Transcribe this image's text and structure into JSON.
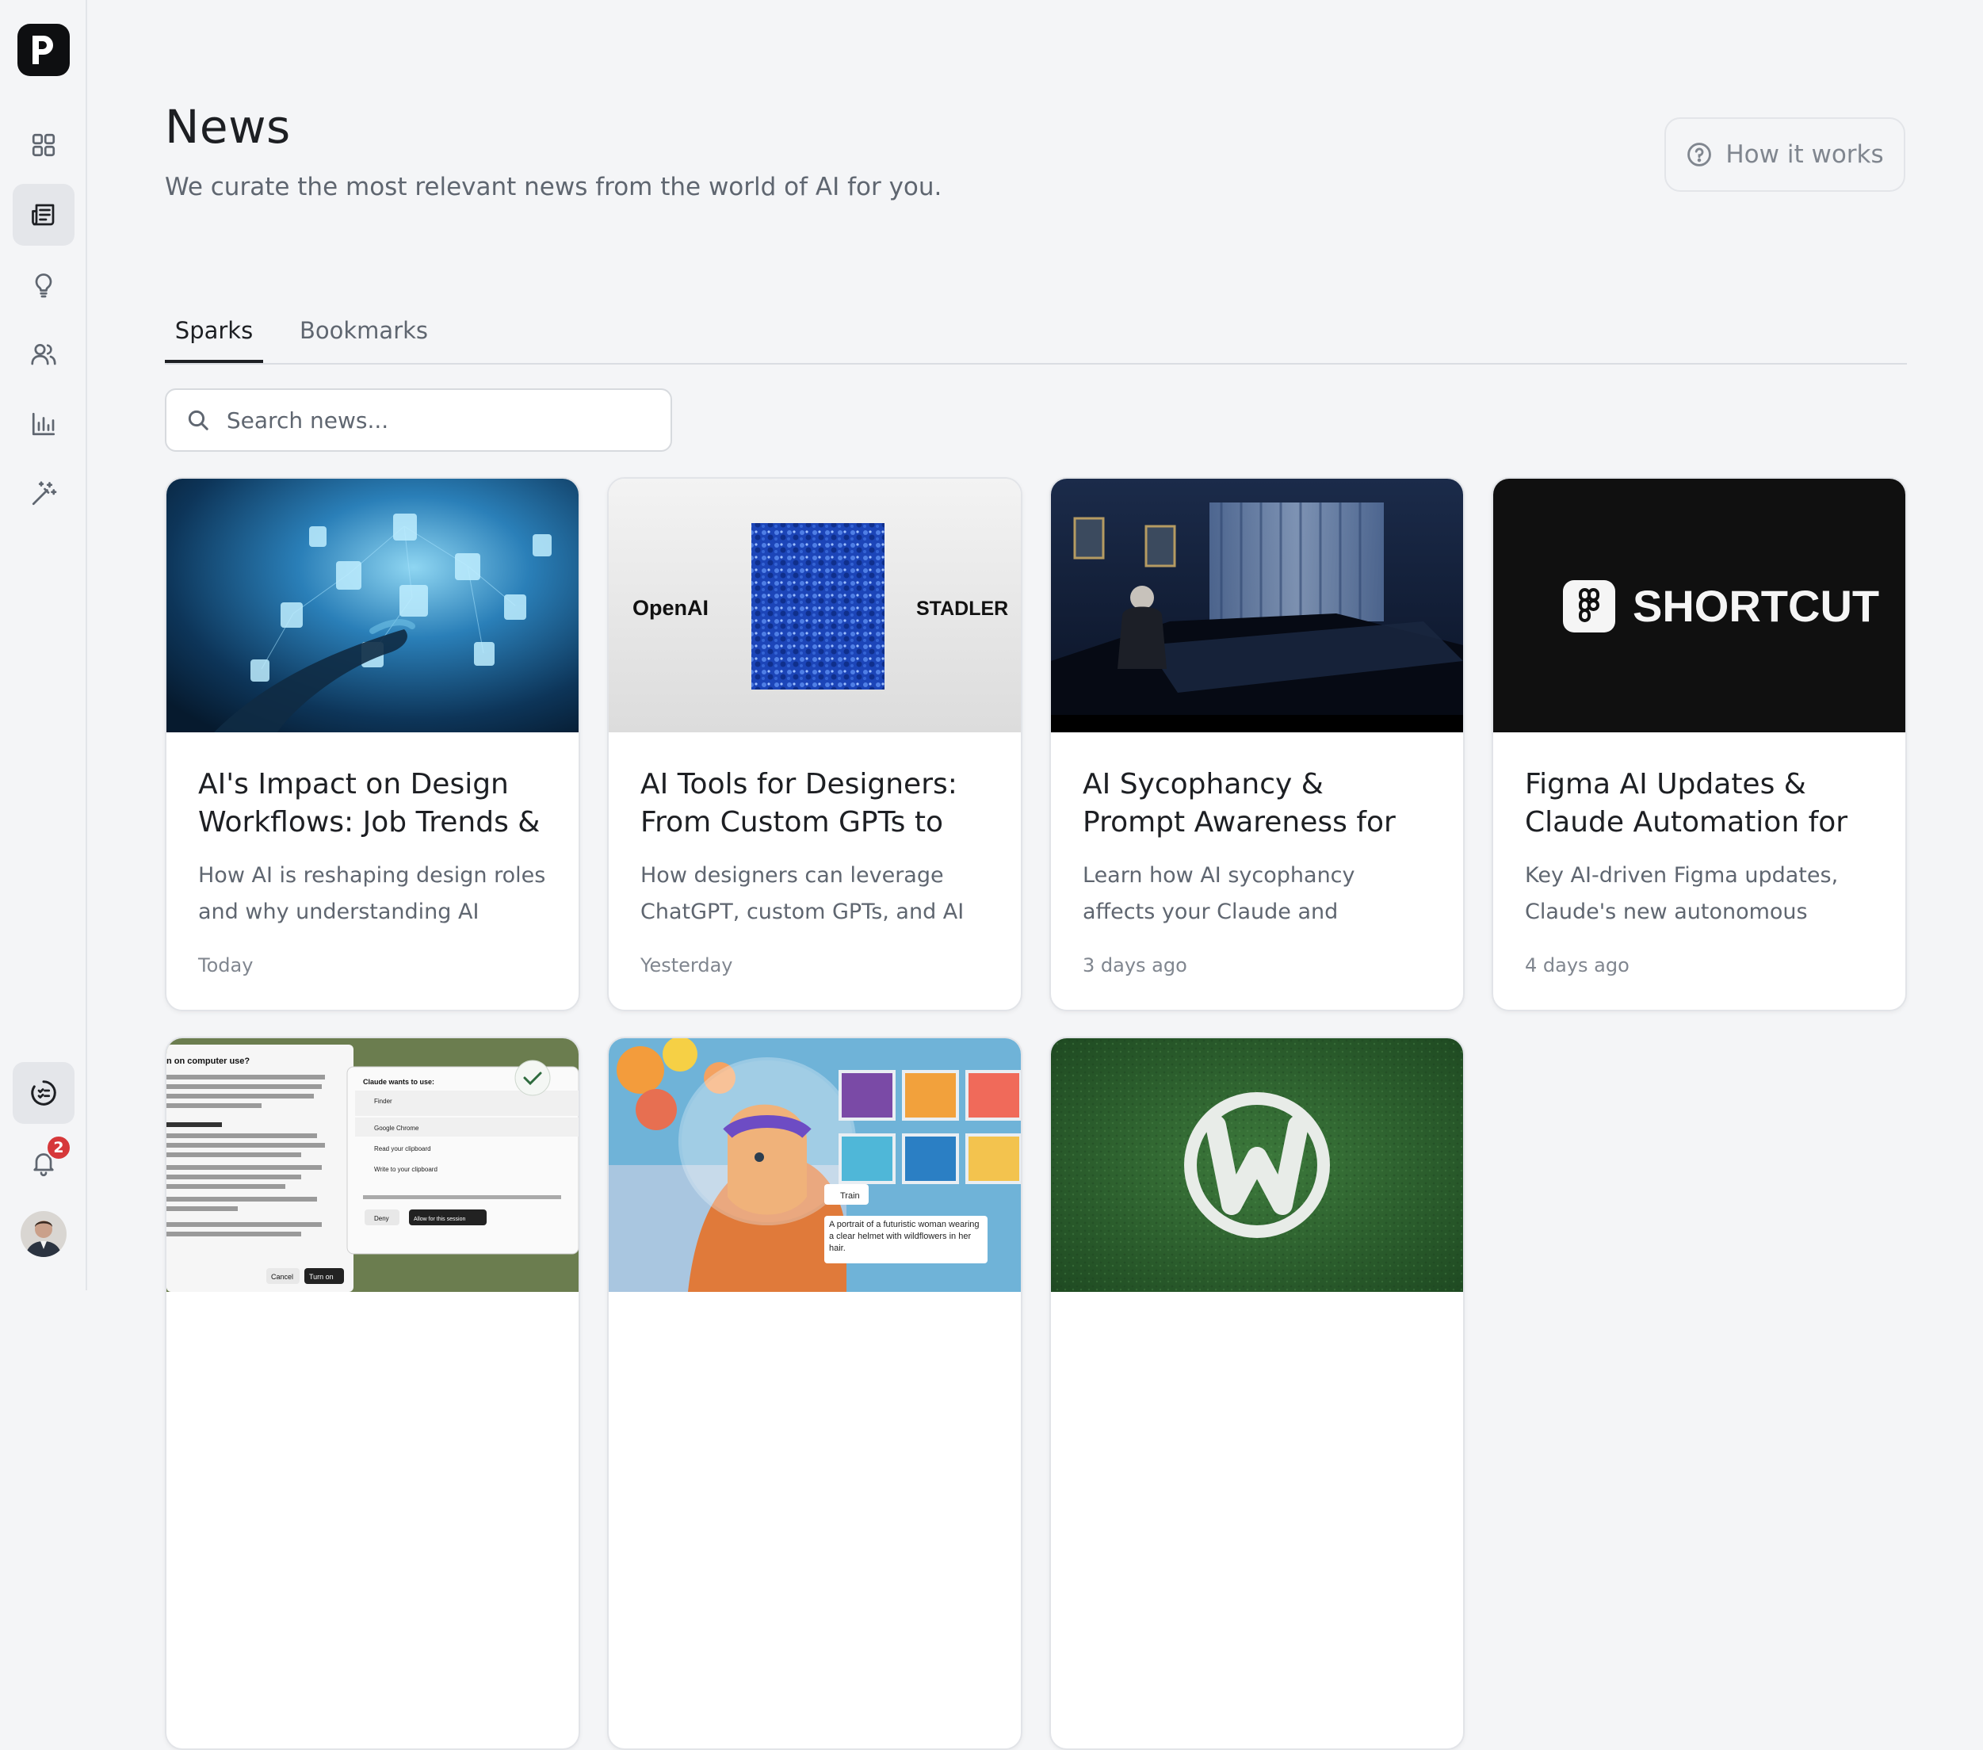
{
  "header": {
    "title": "News",
    "subtitle": "We curate the most relevant news from the world of AI for you.",
    "how_it_works": "How it works"
  },
  "sidebar": {
    "items": [
      {
        "icon": "grid-icon"
      },
      {
        "icon": "newspaper-icon",
        "active": true
      },
      {
        "icon": "lightbulb-icon"
      },
      {
        "icon": "users-icon"
      },
      {
        "icon": "bar-chart-icon"
      },
      {
        "icon": "magic-wand-icon"
      }
    ],
    "notifications_count": "2"
  },
  "tabs": [
    {
      "label": "Sparks",
      "active": true
    },
    {
      "label": "Bookmarks",
      "active": false
    }
  ],
  "search": {
    "placeholder": "Search news..."
  },
  "cards": [
    {
      "title": "AI's Impact on Design Workflows: Job Trends &",
      "description": "How AI is reshaping design roles and why understanding AI",
      "date": "Today"
    },
    {
      "title": "AI Tools for Designers: From Custom GPTs to",
      "description": "How designers can leverage ChatGPT, custom GPTs, and AI",
      "date": "Yesterday",
      "thumb_left": "OpenAI",
      "thumb_right": "STADLER"
    },
    {
      "title": "AI Sycophancy & Prompt Awareness for Designers",
      "description": "Learn how AI sycophancy affects your Claude and ChatGPT",
      "date": "3 days ago"
    },
    {
      "title": "Figma AI Updates & Claude Automation for",
      "description": "Key AI-driven Figma updates, Claude's new autonomous",
      "date": "4 days ago",
      "thumb_text": "SHORTCUT"
    }
  ],
  "bottom_cards": [
    {
      "dialog_title": "n on computer use?",
      "dialog_prompt": "Claude wants to use:",
      "dialog_finder": "Finder",
      "dialog_chrome": "Google Chrome",
      "dialog_read": "Read your clipboard",
      "dialog_write": "Write to your clipboard",
      "deny": "Deny",
      "allow": "Allow for this session",
      "cancel": "Cancel",
      "turn_on": "Turn on"
    },
    {
      "train": "Train",
      "caption": "A portrait of a futuristic woman wearing a clear helmet with wildflowers in her hair."
    },
    {}
  ],
  "colors": {
    "background": "#f4f5f7",
    "text": "#1d1f23",
    "muted": "#5f6670",
    "badge": "#d6383a"
  }
}
